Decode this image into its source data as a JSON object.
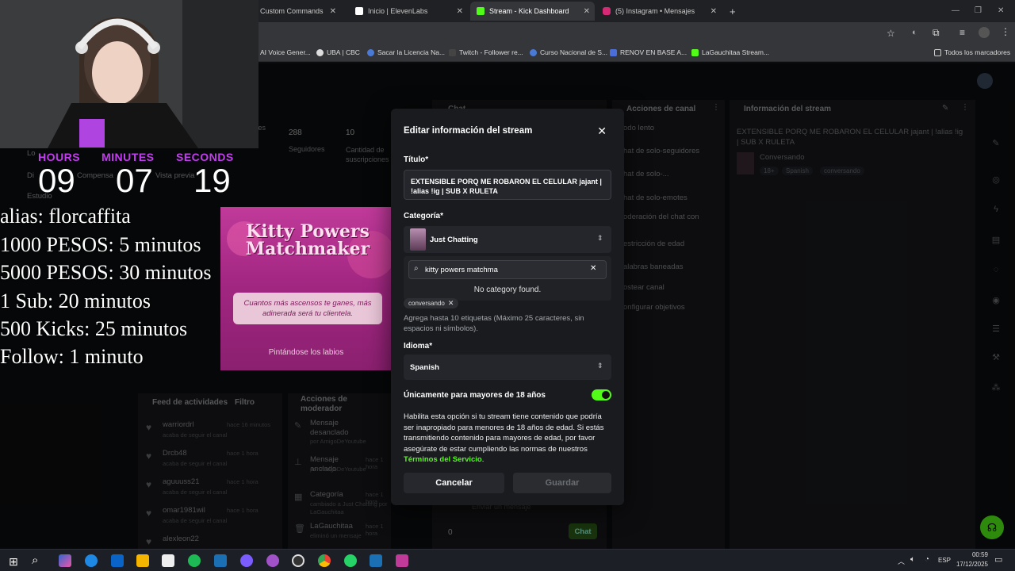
{
  "browser": {
    "tabs": [
      {
        "label": "Custom Commands",
        "active": false
      },
      {
        "label": "Inicio | ElevenLabs",
        "active": false
      },
      {
        "label": "Stream - Kick Dashboard",
        "active": true
      },
      {
        "label": "(5) Instagram • Mensajes",
        "active": false
      }
    ],
    "new_tab": "+",
    "bookmarks": [
      "AI Voice Gener...",
      "UBA | CBC",
      "Sacar la Licencia Na...",
      "Twitch - Follower re...",
      "Curso Nacional de S...",
      "RENOV EN BASE A...",
      "LaGauchitaa Stream..."
    ],
    "all_bookmarks": "Todos los marcadores"
  },
  "overlay": {
    "timer": {
      "hours_label": "HOURS",
      "minutes_label": "MINUTES",
      "seconds_label": "SECONDS",
      "hours": "09",
      "minutes": "07",
      "seconds": "19"
    },
    "lines": [
      "alias: florcaffita",
      "1000 PESOS: 5 minutos",
      "5000 PESOS: 30 minutos",
      "1 Sub: 20 minutos",
      "500 Kicks: 25 minutos",
      "Follow: 1 minuto"
    ]
  },
  "game_ad": {
    "title": "Kitty Powers Matchmaker",
    "line1": "Cuantos más ascensos te ganes, más adinerada será tu clientela.",
    "footer": "Pintándose los labios"
  },
  "dashboard": {
    "stats": [
      {
        "value": "288",
        "label": "Seguidores"
      },
      {
        "value": "10",
        "label": "Cantidad de suscripciones"
      }
    ],
    "espectadores": "Espectadores",
    "sidebar_partial": [
      "Lo",
      "Di",
      "Estudio"
    ],
    "compensation": "Compensa",
    "vista_previa": "Vista previa",
    "chat_title": "Chat",
    "channel_actions_title": "Acciones de canal",
    "channel_actions": [
      "odo lento",
      "hat de solo-seguidores",
      "hat de solo-...",
      "hat de solo-emotes",
      "oderación del chat con",
      "estricción de edad",
      "alabras baneadas",
      "ostear canal",
      "onfigurar objetivos"
    ],
    "stream_info_title": "Información del stream",
    "stream_title": "EXTENSIBLE PORQ ME ROBARON EL CELULAR jajant | !alias !ig | SUB X RULETA",
    "stream_category": "Conversando",
    "stream_tags": [
      "18+",
      "Spanish",
      "conversando"
    ],
    "activity_title": "Feed de actividades",
    "activity_filter": "Filtro",
    "activity": [
      {
        "user": "warriordrl",
        "time": "hace 16 minutos",
        "action": "acaba de seguir el canal"
      },
      {
        "user": "Drcb48",
        "time": "hace 1 hora",
        "action": "acaba de seguir el canal"
      },
      {
        "user": "aguuuss21",
        "time": "hace 1 hora",
        "action": "acaba de seguir el canal"
      },
      {
        "user": "omar1981wil",
        "time": "hace 1 hora",
        "action": "acaba de seguir el canal"
      },
      {
        "user": "alexleon22",
        "time": "",
        "action": ""
      }
    ],
    "mod_title": "Acciones de moderador",
    "mod_actions": [
      {
        "title": "Mensaje desanclado",
        "by": "por AmigoDeYoutube",
        "time": ""
      },
      {
        "title": "Mensaje anclado",
        "by": "por AmigoDeYoutube",
        "time": "hace 1 hora"
      },
      {
        "title": "Categoría",
        "by": "cambiado a Just Chatting por LaGauchitaa",
        "time": "hace 1 hora"
      },
      {
        "title": "LaGauchitaa",
        "by": "eliminó un mensaje",
        "time": "hace 1 hora"
      }
    ],
    "chat_placeholder": "Enviar un mensaje",
    "chat_count": "0",
    "chat_button": "Chat"
  },
  "modal": {
    "title": "Editar información del stream",
    "title_label": "Título*",
    "title_value": "EXTENSIBLE PORQ ME ROBARON EL CELULAR jajant | !alias !ig | SUB X RULETA",
    "category_label": "Categoría*",
    "category_value": "Just Chatting",
    "search_value": "kitty powers matchma",
    "no_category": "No category found.",
    "tag": "conversando",
    "tags_help": "Agrega hasta 10 etiquetas (Máximo 25 caracteres, sin espacios ni símbolos).",
    "language_label": "Idioma*",
    "language_value": "Spanish",
    "adult_label": "Únicamente para mayores de 18 años",
    "adult_on": true,
    "adult_help": "Habilita esta opción si tu stream tiene contenido que podría ser inapropiado para menores de 18 años de edad. Si estás transmitiendo contenido para mayores de edad, por favor asegúrate de estar cumpliendo las normas de nuestros",
    "tos_link": "Términos del Servicio",
    "tos_end": ".",
    "cancel": "Cancelar",
    "save": "Guardar"
  },
  "taskbar": {
    "lang": "ESP",
    "time": "00:59",
    "date": "17/12/2025"
  },
  "colors": {
    "accent": "#53fc18",
    "overlay_purple": "#c43cf0"
  }
}
